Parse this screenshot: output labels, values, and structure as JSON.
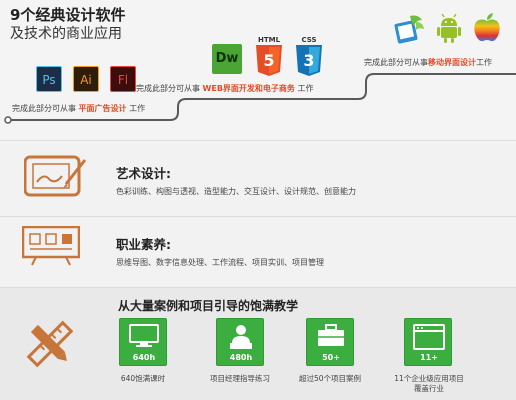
{
  "header": {
    "headline": "9个经典设计软件",
    "subhead": "及技术的商业应用"
  },
  "stages": [
    {
      "prefix": "完成此部分可从事",
      "highlight": "平面广告设计",
      "suffix": "工作"
    },
    {
      "prefix": "完成此部分可从事",
      "highlight": "WEB界面开发和电子商务",
      "suffix": "工作"
    },
    {
      "prefix": "完成此部分可从事",
      "highlight": "移动界面设计",
      "suffix": "工作"
    }
  ],
  "software_icons": [
    {
      "name": "photoshop-icon",
      "label": "Ps",
      "bg": "#1b2e45",
      "fg": "#4ec0f3"
    },
    {
      "name": "illustrator-icon",
      "label": "Ai",
      "bg": "#2f1d0a",
      "fg": "#f29b1c"
    },
    {
      "name": "flash-icon",
      "label": "Fl",
      "bg": "#3b0d0d",
      "fg": "#e8473b"
    },
    {
      "name": "dreamweaver-icon",
      "label": "Dw",
      "bg": "#3d9f2d",
      "fg": "#0f300a"
    },
    {
      "name": "html5-icon",
      "label": "5",
      "caption": "HTML",
      "bg": "#e44d26",
      "fg": "#ffffff"
    },
    {
      "name": "css3-icon",
      "label": "3",
      "caption": "CSS",
      "bg": "#2779c7",
      "fg": "#ffffff"
    }
  ],
  "features": [
    {
      "title": "艺术设计:",
      "desc": "色彩训练、构图与透视、造型能力、交互设计、设计规范、创意能力"
    },
    {
      "title": "职业素养:",
      "desc": "思维导图、数字信息处理、工作流程、项目实训、项目管理"
    }
  ],
  "bottom": {
    "title": "从大量案例和项目引导的饱满教学",
    "tiles": [
      {
        "value": "640h",
        "label": "640饱满课时",
        "icon": "monitor-icon"
      },
      {
        "value": "480h",
        "label": "项目经理指导练习",
        "icon": "instructor-icon"
      },
      {
        "value": "50+",
        "label": "超过50个项目案例",
        "icon": "briefcase-icon"
      },
      {
        "value": "11+",
        "label": "11个企业级应用项目 覆盖行业",
        "label_line1": "11个企业级应用项目",
        "label_line2": "覆盖行业",
        "icon": "browser-window-icon"
      }
    ]
  },
  "colors": {
    "accent_orange": "#c8753a",
    "highlight_red": "#e34b27",
    "tile_green": "#3cad3f",
    "stair_line": "#5a5a5a"
  }
}
